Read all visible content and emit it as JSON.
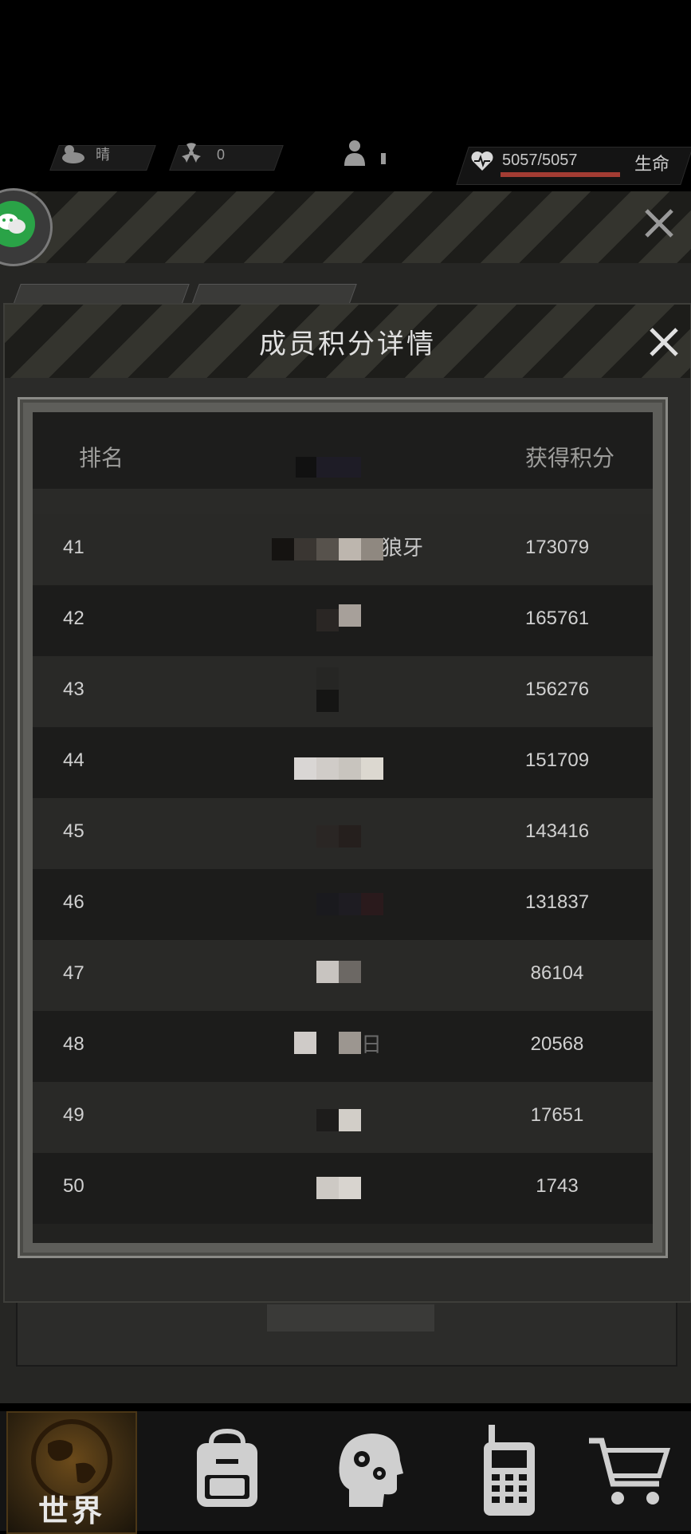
{
  "status": {
    "weather_label": "晴",
    "radiation_value": "0",
    "hp_text": "5057/5057",
    "hp_fraction": 1.0,
    "hp_label": "生命"
  },
  "modal": {
    "title": "成员积分详情",
    "columns": {
      "rank": "排名",
      "score": "获得积分"
    },
    "rows": [
      {
        "rank": "41",
        "name": "狼牙",
        "score": "173079"
      },
      {
        "rank": "42",
        "name": "",
        "score": "165761"
      },
      {
        "rank": "43",
        "name": "",
        "score": "156276"
      },
      {
        "rank": "44",
        "name": "",
        "score": "151709"
      },
      {
        "rank": "45",
        "name": "",
        "score": "143416"
      },
      {
        "rank": "46",
        "name": "",
        "score": "131837"
      },
      {
        "rank": "47",
        "name": "",
        "score": "86104"
      },
      {
        "rank": "48",
        "name": "日",
        "score": "20568"
      },
      {
        "rank": "49",
        "name": "",
        "score": "17651"
      },
      {
        "rank": "50",
        "name": "",
        "score": "1743"
      }
    ]
  },
  "nav": {
    "world_label": "世界",
    "icons": [
      "globe-icon",
      "backpack-icon",
      "head-gears-icon",
      "walkie-talkie-icon",
      "cart-icon"
    ]
  },
  "colors": {
    "hp_bar": "#a23c33",
    "wechat_green": "#2aa347",
    "world_tab": "#6b4a1a"
  }
}
